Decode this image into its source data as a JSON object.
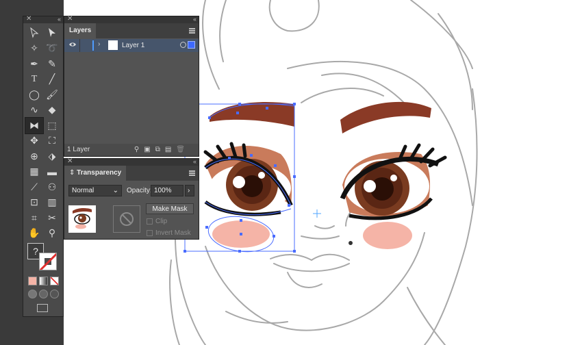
{
  "layers_panel": {
    "tab_label": "Layers",
    "layer_name": "Layer 1",
    "layer_count": "1 Layer"
  },
  "transparency_panel": {
    "tab_label": "Transparency",
    "blend_mode": "Normal",
    "opacity_label": "Opacity:",
    "opacity_value": "100%",
    "make_mask_label": "Make Mask",
    "clip_label": "Clip",
    "invert_mask_label": "Invert Mask"
  },
  "tools_panel": {
    "default_fill_label": "?"
  },
  "colors": {
    "selection_blue": "#4a6cff",
    "eyebrow": "#8a3a26",
    "eyeshadow": "#c97b5b",
    "iris": "#5a2614",
    "blush": "#f5b4a7",
    "layer_row_bg": "#46556b"
  }
}
